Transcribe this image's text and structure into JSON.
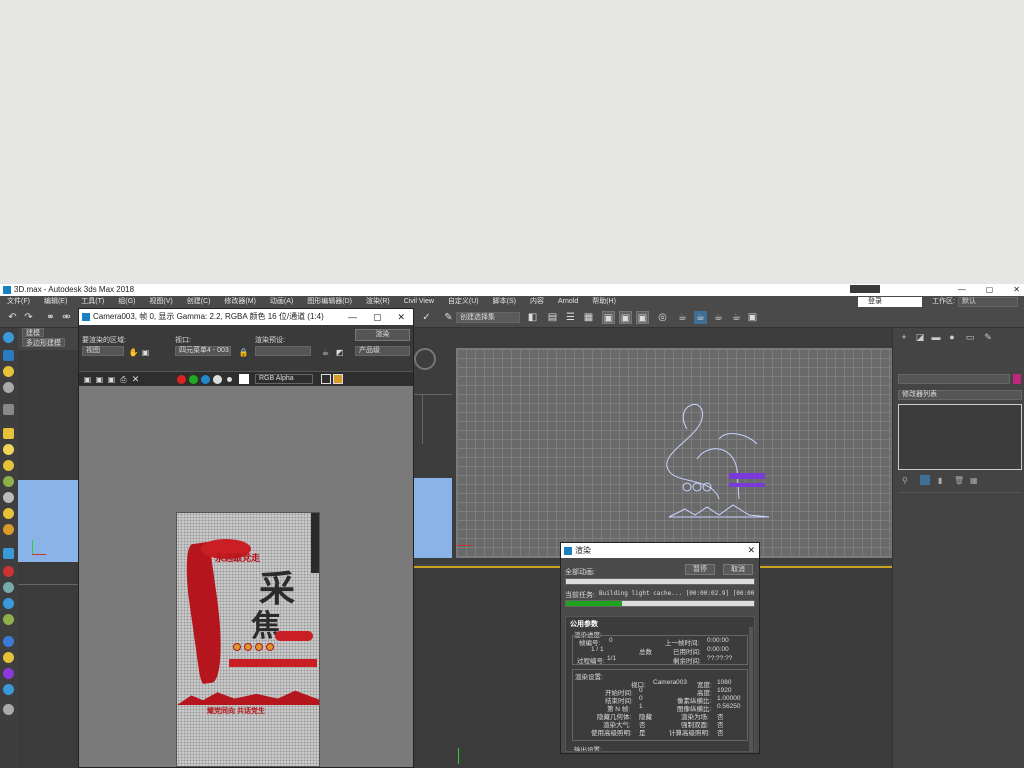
{
  "app": {
    "title": "3D.max - Autodesk 3ds Max 2018",
    "window_controls": [
      "—",
      "▢",
      "✕"
    ]
  },
  "menu": {
    "items": [
      "文件(F)",
      "编辑(E)",
      "工具(T)",
      "组(G)",
      "视图(V)",
      "创建(C)",
      "修改器(M)",
      "动画(A)",
      "图形编辑器(D)",
      "渲染(R)",
      "Civil View",
      "自定义(U)",
      "脚本(S)",
      "内容",
      "Arnold",
      "帮助(H)"
    ],
    "login": "登录",
    "workspace_label": "工作区:",
    "workspace_value": "默认"
  },
  "toolbar": {
    "selection_set": "创建选择集"
  },
  "command_panel": {
    "tab_modeling": "建模",
    "tab_poly": "多边形建模"
  },
  "right_panel": {
    "modifier_list": "修改器列表"
  },
  "frame_buffer": {
    "title": "Camera003, 帧 0, 显示 Gamma: 2.2, RGBA 颜色 16 位/通道 (1:4)",
    "area_label": "要渲染的区域:",
    "area_value": "视图",
    "viewport_label": "视口:",
    "viewport_value": "四元菜单4 - 003",
    "preset_label": "渲染预设:",
    "preset_value": "",
    "render_button": "渲染",
    "product_value": "产品级",
    "channel_value": "RGB Alpha"
  },
  "poster": {
    "calligraphy1": "采",
    "calligraphy2": "焦",
    "red_title": "永远跟党走",
    "red_sub": "",
    "bottom_text": "耀党同向 共话党生"
  },
  "render_dialog": {
    "title": "渲染",
    "all_animation_label": "全部动画:",
    "pause_button": "暂停",
    "cancel_button": "取消",
    "current_task_label": "当前任务:",
    "current_task_value": "Building light cache... [00:00:02.9] [00:00:0",
    "progress": 0.3,
    "common_params": "公用参数",
    "render_progress": "渲染进度:",
    "frame_no_label": "帧编号:",
    "frame_no": "0",
    "last_frame_label": "上一帧时间:",
    "last_frame": "0:00:00",
    "frames_count": "1 / 1",
    "total_label": "总数",
    "elapsed_label": "已用时间:",
    "elapsed": "0:00:00",
    "pass_label": "过程编号:",
    "pass_value": "1/1",
    "remaining_label": "剩余时间:",
    "remaining": "??:??:??",
    "render_settings": "渲染设置:",
    "viewport_label": "视口:",
    "viewport_value": "Camera003",
    "width_label": "宽度:",
    "width_value": "1080",
    "start_label": "开始时间:",
    "start_value": "0",
    "height_label": "高度:",
    "height_value": "1920",
    "end_label": "结束时间:",
    "end_value": "0",
    "pixel_aspect_label": "像素纵横比:",
    "pixel_aspect_value": "1.00000",
    "nth_label": "第 N 帧:",
    "nth_value": "1",
    "image_aspect_label": "图像纵横比:",
    "image_aspect_value": "0.56250",
    "hidden_geo_label": "隐藏几何体:",
    "hidden_geo_value": "隐藏",
    "render_field_label": "渲染为场:",
    "render_field_value": "否",
    "atmos_label": "渲染大气:",
    "atmos_value": "否",
    "force_2side_label": "强制双面:",
    "force_2side_value": "否",
    "adv_light_label": "使用高级照明:",
    "adv_light_value": "是",
    "calc_adv_label": "计算高级照明:",
    "calc_adv_value": "否",
    "output_label": "输出设置:"
  },
  "colors": {
    "accent_yellow": "#c9a21f",
    "progress_green": "#1fa31f",
    "viewport_blue": "#8ab4e8",
    "poster_red": "#b5151d"
  }
}
